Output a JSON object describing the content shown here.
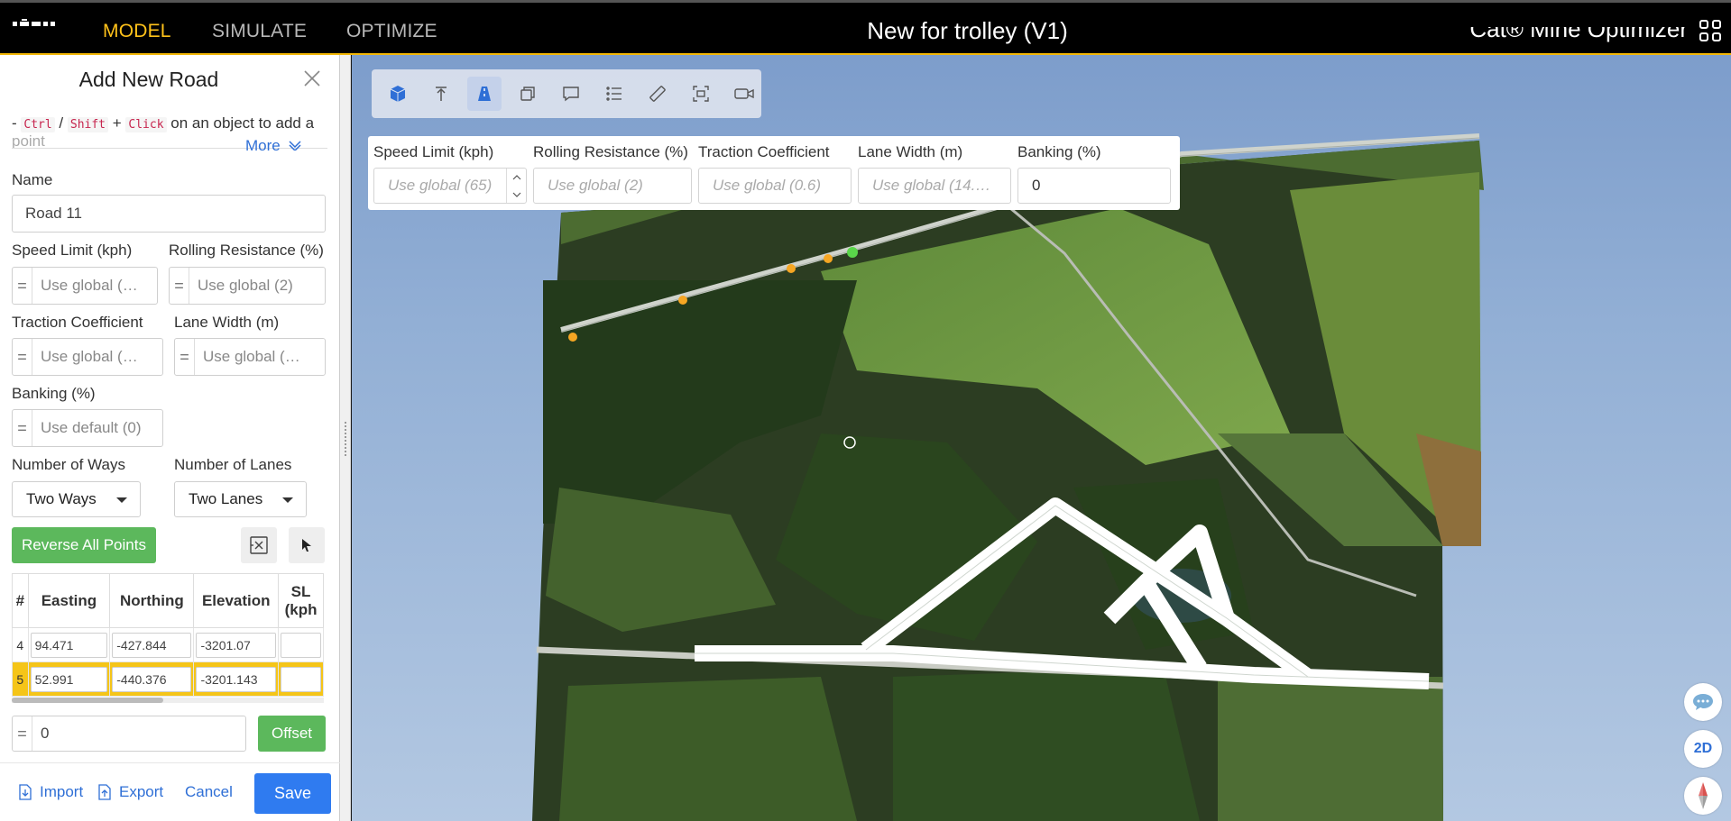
{
  "topbar": {
    "tabs": [
      "MODEL",
      "SIMULATE",
      "OPTIMIZE"
    ],
    "active_tab": "MODEL",
    "title": "New for trolley (V1)",
    "brand": "Cat® Mine Optimizer",
    "accent": "#ffc21a"
  },
  "panel": {
    "title": "Add New Road",
    "hint": {
      "prefix": "- ",
      "key1": "Ctrl",
      "sep1": " / ",
      "key2": "Shift",
      "sep2": " + ",
      "key3": "Click",
      "text": " on an object to add a",
      "faded": "point"
    },
    "more_label": "More",
    "name_label": "Name",
    "name_value": "Road 11",
    "speed_label": "Speed Limit (kph)",
    "speed_placeholder": "Use global (…",
    "rolling_label": "Rolling Resistance (%)",
    "rolling_placeholder": "Use global (2)",
    "traction_label": "Traction Coefficient",
    "traction_placeholder": "Use global (…",
    "lane_width_label": "Lane Width (m)",
    "lane_width_placeholder": "Use global (…",
    "banking_label": "Banking (%)",
    "banking_placeholder": "Use default (0)",
    "ways_label": "Number of Ways",
    "ways_value": "Two Ways",
    "lanes_label": "Number of Lanes",
    "lanes_value": "Two Lanes",
    "reverse_label": "Reverse All Points",
    "offset_value": "0",
    "offset_label": "Offset",
    "import_label": "Import",
    "export_label": "Export",
    "cancel_label": "Cancel",
    "save_label": "Save"
  },
  "points_table": {
    "headers": [
      "#",
      "Easting",
      "Northing",
      "Elevation",
      "SL (kph"
    ],
    "rows": [
      {
        "idx": "4",
        "easting": "94.471",
        "northing": "-427.844",
        "elevation": "-3201.07"
      },
      {
        "idx": "5",
        "easting": "52.991",
        "northing": "-440.376",
        "elevation": "-3201.143"
      }
    ],
    "selected_row": "5"
  },
  "map_props": {
    "speed_label": "Speed Limit (kph)",
    "speed_placeholder": "Use global (65)",
    "rolling_label": "Rolling Resistance (%)",
    "rolling_placeholder": "Use global (2)",
    "traction_label": "Traction Coefficient",
    "traction_placeholder": "Use global (0.6)",
    "lane_width_label": "Lane Width (m)",
    "lane_width_placeholder": "Use global (14.…",
    "banking_label": "Banking (%)",
    "banking_value": "0"
  },
  "map_side": {
    "view_toggle": "2D"
  },
  "toolbar_icons": [
    "cube-icon",
    "elevation-icon",
    "road-icon",
    "layers-icon",
    "comment-icon",
    "list-icon",
    "ruler-icon",
    "capture-icon",
    "camera-icon"
  ]
}
